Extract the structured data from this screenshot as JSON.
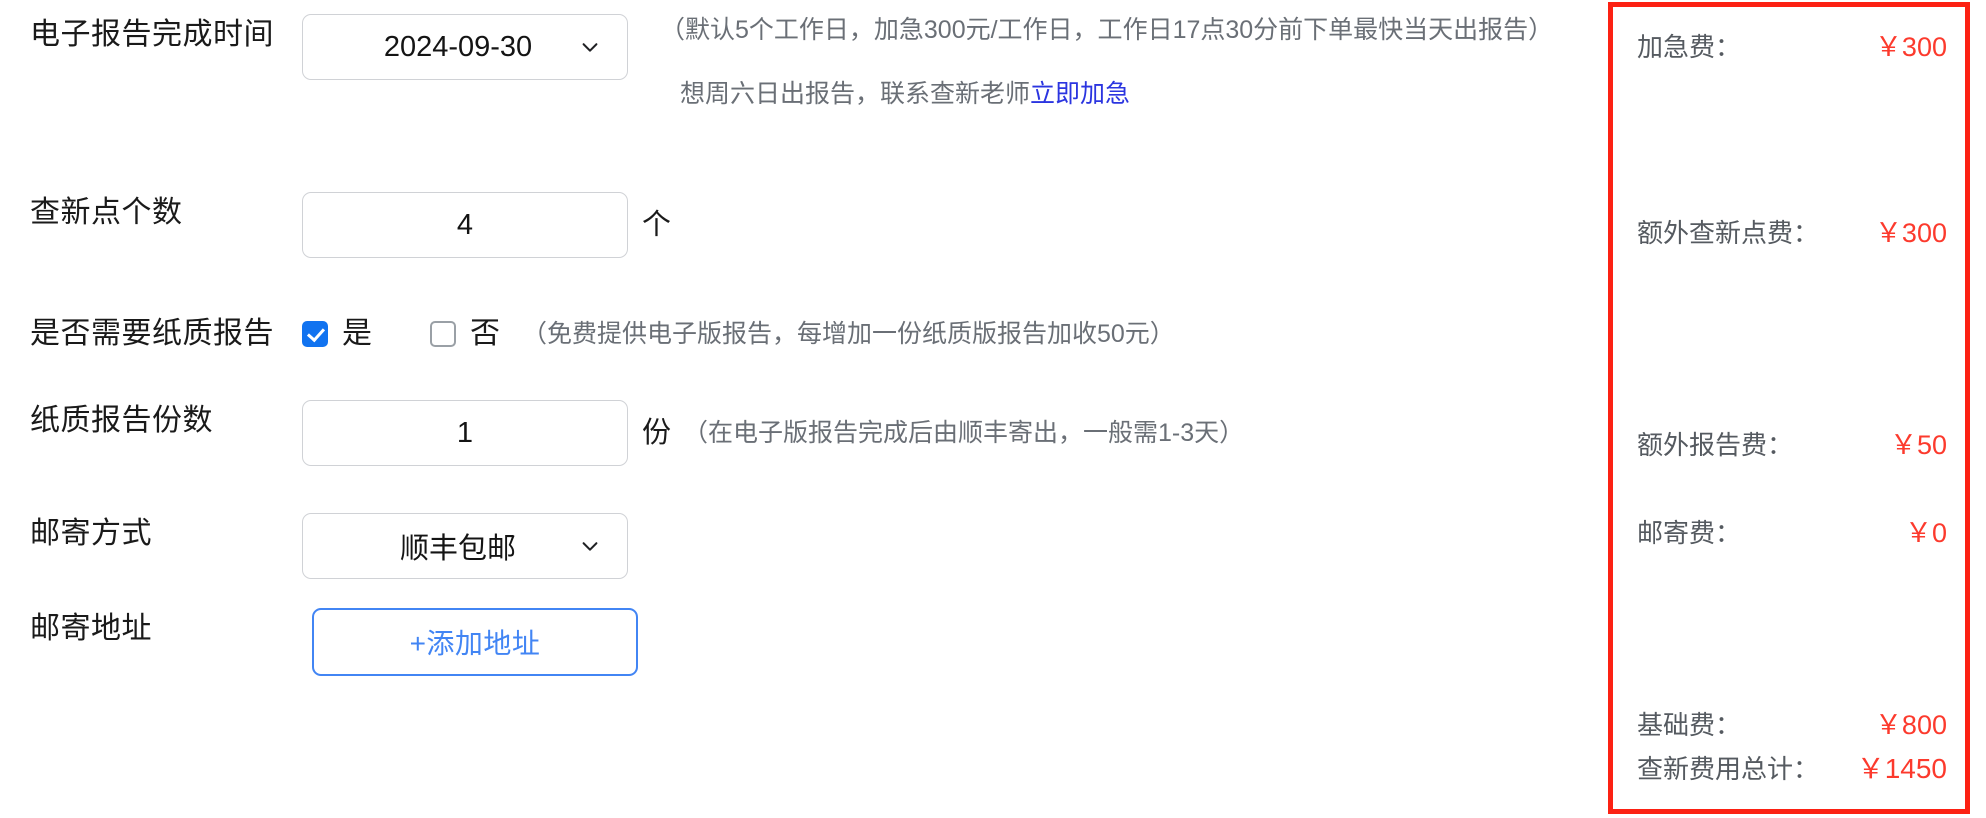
{
  "form": {
    "rows": [
      {
        "label": "电子报告完成时间",
        "control": "select",
        "value": "2024-09-30",
        "icon": "chevron-down-icon"
      },
      {
        "label": "查新点个数",
        "control": "number",
        "value": "4",
        "unit": "个"
      },
      {
        "label": "是否需要纸质报告",
        "control": "checkbox-group",
        "options": [
          {
            "label": "是",
            "checked": true
          },
          {
            "label": "否",
            "checked": false
          }
        ],
        "hint": "（免费提供电子版报告，每增加一份纸质版报告加收50元）"
      },
      {
        "label": "纸质报告份数",
        "control": "number",
        "value": "1",
        "unit": "份",
        "hint": "（在电子版报告完成后由顺丰寄出，一般需1-3天）"
      },
      {
        "label": "邮寄方式",
        "control": "select",
        "value": "顺丰包邮",
        "icon": "chevron-down-icon"
      },
      {
        "label": "邮寄地址",
        "control": "button",
        "button_label": "+添加地址"
      }
    ],
    "date_hint": {
      "paragraph": "（默认5个工作日，加急300元/工作日，工作日17点30分前下单最快当天出报告）",
      "line2_prefix": "想周六日出报告，联系查新老师",
      "line2_link": "立即加急"
    }
  },
  "fee_panel": {
    "border_color": "#fc2113",
    "value_color": "#fc3a2d",
    "items": [
      {
        "label": "加急费：",
        "value": "￥300"
      },
      {
        "label": "额外查新点费：",
        "value": "￥300"
      },
      {
        "label": "额外报告费：",
        "value": "￥50"
      },
      {
        "label": "邮寄费：",
        "value": "￥0"
      },
      {
        "label": "基础费：",
        "value": "￥800"
      },
      {
        "label": "查新费用总计：",
        "value": "￥1450"
      }
    ]
  }
}
